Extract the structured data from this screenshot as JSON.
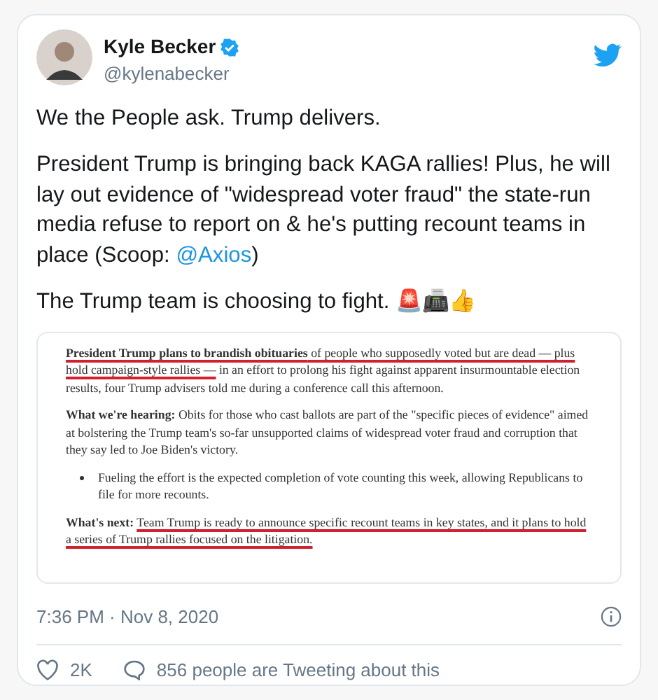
{
  "author": {
    "name": "Kyle Becker",
    "handle": "@kylenabecker",
    "verified": true
  },
  "tweet_text": [
    {
      "segments": [
        {
          "kind": "text",
          "text": "We the People ask. Trump delivers."
        }
      ]
    },
    {
      "segments": [
        {
          "kind": "text",
          "text": "President Trump is bringing back KAGA rallies! Plus, he will lay out evidence of \"widespread voter fraud\" the state-run media refuse to report on & he's putting recount teams in place (Scoop: "
        },
        {
          "kind": "mention",
          "text": "@Axios"
        },
        {
          "kind": "text",
          "text": ")"
        }
      ]
    },
    {
      "segments": [
        {
          "kind": "text",
          "text": "The Trump team is choosing to fight. 🚨📠👍"
        }
      ]
    }
  ],
  "article": [
    {
      "kind": "paragraph",
      "segments": [
        {
          "kind": "underlined",
          "text": "**President Trump plans to brandish obituaries** of people who supposedly voted but are dead — plus hold campaign-style rallies —"
        },
        {
          "kind": "plain",
          "text": " in an effort to prolong his fight against apparent insurmountable election results, four Trump advisers told me during a conference call this afternoon."
        }
      ]
    },
    {
      "kind": "paragraph",
      "segments": [
        {
          "kind": "plain",
          "text": "**What we're hearing:** Obits for those who cast ballots are part of the \"specific pieces of evidence\" aimed at bolstering the Trump team's so-far unsupported claims of widespread voter fraud and corruption that they say led to Joe Biden's victory."
        }
      ]
    },
    {
      "kind": "bullet",
      "segments": [
        {
          "kind": "plain",
          "text": "Fueling the effort is the expected completion of vote counting this week, allowing Republicans to file for more recounts."
        }
      ]
    },
    {
      "kind": "paragraph",
      "segments": [
        {
          "kind": "plain",
          "text": "**What's next:** "
        },
        {
          "kind": "underlined",
          "text": "Team Trump is ready to announce specific recount teams in key states, and it plans to hold a series of Trump rallies focused on the litigation."
        }
      ]
    }
  ],
  "timestamp": "7:36 PM · Nov 8, 2020",
  "likes": "2K",
  "replies_text": "856 people are Tweeting about this"
}
